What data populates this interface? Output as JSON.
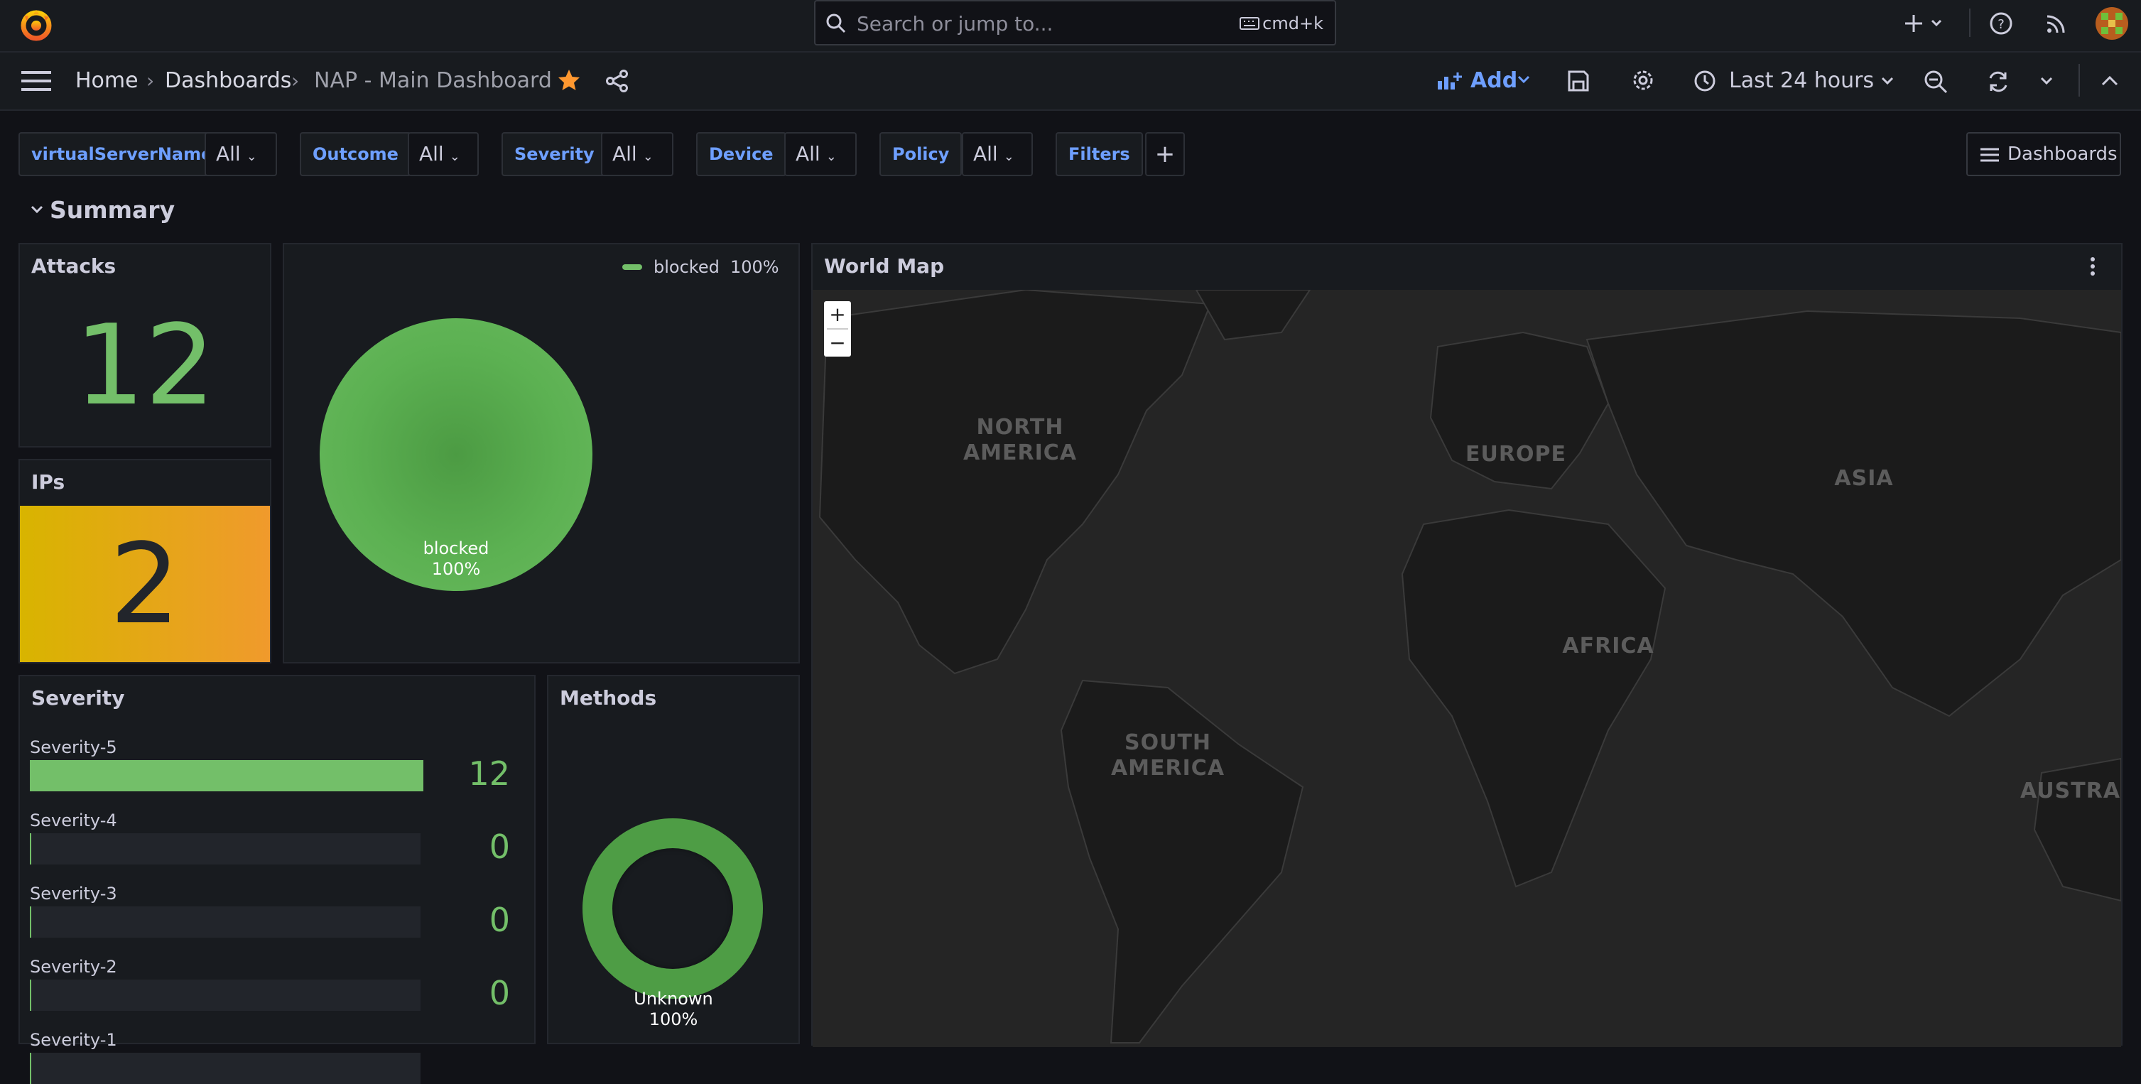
{
  "topbar": {
    "search_placeholder": "Search or jump to...",
    "search_shortcut": "cmd+k"
  },
  "breadcrumb": [
    "Home",
    "Dashboards",
    "NAP - Main Dashboard"
  ],
  "toolbar": {
    "add_label": "Add",
    "time_range": "Last 24 hours"
  },
  "variables": [
    {
      "label": "virtualServerName",
      "value": "All"
    },
    {
      "label": "Outcome",
      "value": "All"
    },
    {
      "label": "Severity",
      "value": "All"
    },
    {
      "label": "Device",
      "value": "All"
    },
    {
      "label": "Policy",
      "value": "All"
    }
  ],
  "filters_label": "Filters",
  "dashboards_button": "Dashboards",
  "row_title": "Summary",
  "panels": {
    "attacks": {
      "title": "Attacks",
      "value": "12"
    },
    "ips": {
      "title": "IPs",
      "value": "2"
    },
    "outcome_pie": {
      "legend_name": "blocked",
      "legend_pct": "100%",
      "slice_label": "blocked",
      "slice_pct": "100%"
    },
    "world_map": {
      "title": "World Map",
      "zoom_in": "+",
      "zoom_out": "−",
      "labels": [
        "NORTH AMERICA",
        "EUROPE",
        "ASIA",
        "AFRICA",
        "SOUTH AMERICA",
        "AUSTRA"
      ]
    },
    "severity": {
      "title": "Severity",
      "items": [
        {
          "label": "Severity-5",
          "value": "12",
          "fraction": 1.0
        },
        {
          "label": "Severity-4",
          "value": "0",
          "fraction": 0
        },
        {
          "label": "Severity-3",
          "value": "0",
          "fraction": 0
        },
        {
          "label": "Severity-2",
          "value": "0",
          "fraction": 0
        },
        {
          "label": "Severity-1",
          "value": "",
          "fraction": 0
        }
      ]
    },
    "methods": {
      "title": "Methods",
      "slice_label": "Unknown",
      "slice_pct": "100%"
    }
  },
  "colors": {
    "background": "#111217",
    "panel": "#181b1f",
    "accent_blue": "#6e9fff",
    "green": "#73bf69",
    "star": "#ff9830",
    "ips_gradient_start": "#d8b400",
    "ips_gradient_end": "#f09a2c"
  }
}
